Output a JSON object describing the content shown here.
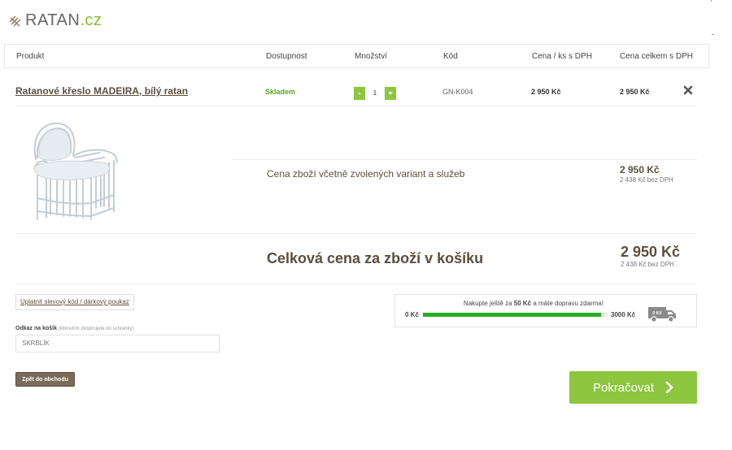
{
  "logo": {
    "name": "RATAN",
    "tld": ".cz"
  },
  "table": {
    "headers": [
      "Produkt",
      "Dostupnost",
      "Množství",
      "Kód",
      "Cena / ks s DPH",
      "Cena celkem s DPH"
    ]
  },
  "item": {
    "name": "Ratanové křeslo MADEIRA, bílý ratan",
    "availability": "Skladem",
    "qty_minus": "-",
    "quantity": "1",
    "qty_plus": "+",
    "code": "GN-K004",
    "unit_price": "2 950 Kč",
    "total_price": "2 950 Kč"
  },
  "subtotal": {
    "label": "Cena zboží včetně zvolených variant a služeb",
    "price": "2 950 Kč",
    "net": "2 438 Kč bez DPH"
  },
  "total": {
    "label": "Celková cena za zboží v košíku",
    "price": "2 950 Kč",
    "net": "2 438 Kč bez DPH"
  },
  "coupon": {
    "label": "Uplatnit slevový kód / dárkový poukaz"
  },
  "cart_link": {
    "label": "Odkaz na košík",
    "hint": "(kliknutím zkopírujete do schránky)",
    "value": "SKRBLÍK"
  },
  "back_button": {
    "label": "Zpět do obchodu"
  },
  "shipping": {
    "msg_before": "Nakupte ještě za",
    "msg_amount": "50 Kč",
    "msg_after": "a máte dopravu zdarma!",
    "min": "0 Kč",
    "max": "3000 Kč",
    "progress_pct": 98,
    "truck_label": "0 Kč"
  },
  "continue_button": {
    "label": "Pokračovat"
  },
  "colors": {
    "accent": "#8dc63f",
    "brown": "#5a4f3e",
    "progress": "#22b022"
  }
}
